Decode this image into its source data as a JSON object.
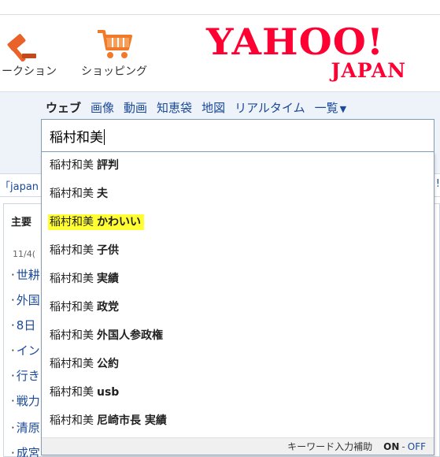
{
  "services": {
    "auction_label": "ークション",
    "shopping_label": "ショッピング"
  },
  "logo": {
    "main": "YAHOO!",
    "sub": "JAPAN"
  },
  "tabs": [
    {
      "label": "ウェブ"
    },
    {
      "label": "画像"
    },
    {
      "label": "動画"
    },
    {
      "label": "知恵袋"
    },
    {
      "label": "地図"
    },
    {
      "label": "リアルタイム"
    },
    {
      "label": "一覧"
    }
  ],
  "search": {
    "value": "稲村和美"
  },
  "background": {
    "quote": "「japan",
    "right_fragment": "!",
    "news_tab": "主要",
    "news_date": "11/4(",
    "news_items": [
      "世耕",
      "外国",
      "8日",
      "イン",
      "行き",
      "戦力",
      "清原",
      "成宮"
    ]
  },
  "suggestions": {
    "query": "稲村和美",
    "items": [
      {
        "rest": "評判"
      },
      {
        "rest": "夫"
      },
      {
        "rest": "かわいい"
      },
      {
        "rest": "子供"
      },
      {
        "rest": "実績"
      },
      {
        "rest": "政党"
      },
      {
        "rest": "外国人参政権"
      },
      {
        "rest": "公約"
      },
      {
        "rest": "usb"
      },
      {
        "rest": "尼崎市長 実績"
      }
    ],
    "footer_label": "キーワード入力補助",
    "on": "ON",
    "sep": "-",
    "off": "OFF"
  },
  "colors": {
    "brand": "#ff0033",
    "link": "#1a4a99",
    "highlight": "#ffff33"
  }
}
